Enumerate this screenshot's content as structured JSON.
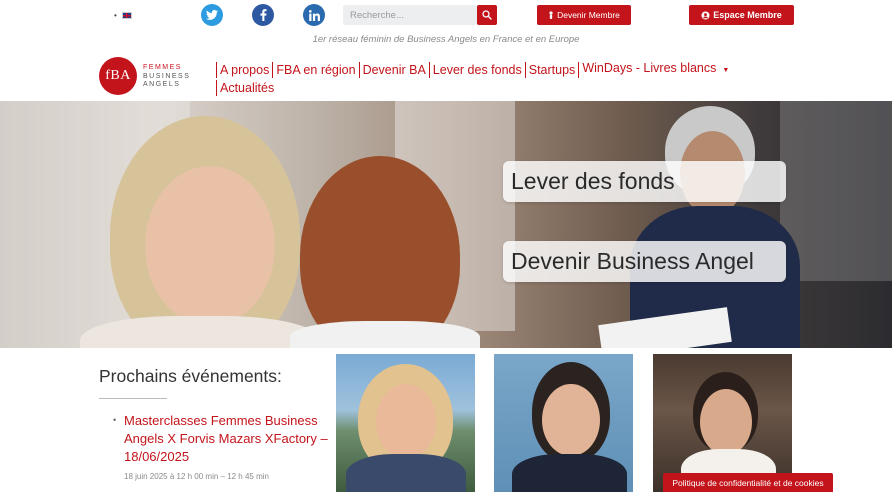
{
  "header": {
    "lang_dot": "•",
    "search_placeholder": "Recherche...",
    "devenir_membre": "Devenir Membre",
    "espace_membre": "Espace Membre",
    "tagline": "1er réseau féminin de Business Angels en France et en Europe",
    "icons": [
      "uk-flag-icon",
      "twitter-icon",
      "facebook-icon",
      "linkedin-icon",
      "search-icon",
      "user-icon"
    ]
  },
  "logo": {
    "monogram": "fBA",
    "line1": "FEMMES",
    "line2": "BUSINESS",
    "line3": "ANGELS"
  },
  "nav": {
    "items": [
      "A propos",
      "FBA en région",
      "Devenir BA",
      "Lever des fonds",
      "Startups",
      "WinDays - Livres blancs",
      "Actualités"
    ]
  },
  "hero": {
    "cta1": "Lever des fonds",
    "cta2": "Devenir Business Angel"
  },
  "events": {
    "heading": "Prochains événements:",
    "items": [
      {
        "title": "Masterclasses Femmes Business Angels X Forvis Mazars XFactory – 18/06/2025",
        "date": "18 juin 2025 à 12 h 00 min – 12 h 45 min"
      }
    ]
  },
  "cookie_banner": "Politique de confidentialité et de cookies",
  "colors": {
    "brand_red": "#c3141b",
    "twitter": "#2d9be0",
    "facebook": "#2d59a3",
    "linkedin": "#2a6bb0"
  }
}
